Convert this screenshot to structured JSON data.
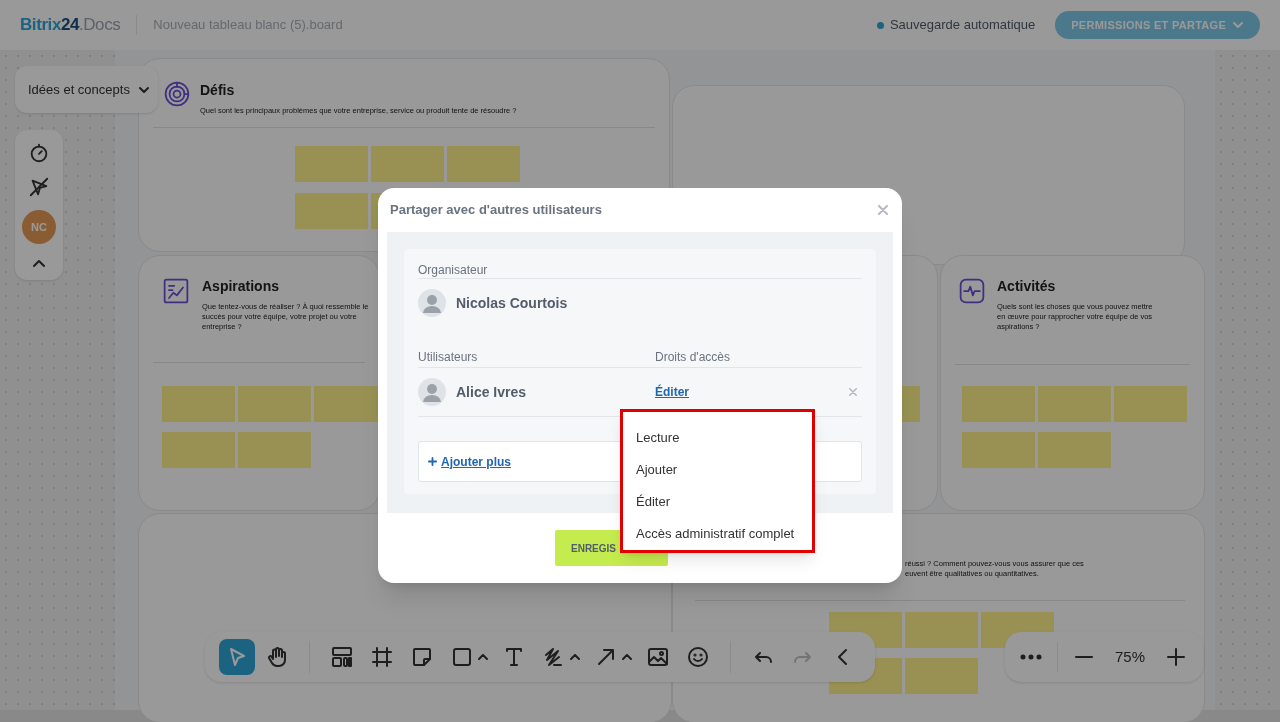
{
  "header": {
    "logo": {
      "brand": "Bitrix",
      "number": "24",
      "suffix": ".Docs"
    },
    "file_name": "Nouveau tableau blanc (5).board",
    "autosave": "Sauvegarde automatique",
    "share_button": "PERMISSIONS ET PARTAGE"
  },
  "board_menu": {
    "label": "Idées et concepts"
  },
  "side_tools": [
    {
      "kind": "timer"
    },
    {
      "kind": "cursor_off"
    },
    {
      "kind": "avatar",
      "initials": "NC"
    },
    {
      "kind": "collapse"
    }
  ],
  "cards": [
    {
      "title": "Défis",
      "description": "Quel sont les principaux problèmes que votre entreprise, service ou produit tente de résoudre ?"
    },
    {
      "title": "Aspirations",
      "description": "Que tentez-vous de réaliser ? À quoi ressemble le succès pour votre équipe, votre projet ou votre entreprise ?"
    },
    {
      "title": "Activités",
      "description": "Quels sont les choses que vous pouvez mettre en œuvre pour rapprocher votre équipe de vos aspirations ?"
    }
  ],
  "partial_card_text": [
    "réussi ? Comment pouvez-vous vous assurer que ces",
    "euvent être qualitatives ou quantitatives."
  ],
  "toolbar": {
    "groups": [
      [
        {
          "kind": "select",
          "selected": true
        },
        {
          "kind": "hand",
          "selected": false
        }
      ],
      [
        {
          "kind": "layout",
          "selected": false
        },
        {
          "kind": "frame",
          "selected": false
        },
        {
          "kind": "sticky",
          "selected": false
        },
        {
          "kind": "shape",
          "selected": false,
          "has_menu": true
        },
        {
          "kind": "text",
          "selected": false
        },
        {
          "kind": "pen",
          "selected": false,
          "has_menu": true
        },
        {
          "kind": "arrow",
          "selected": false,
          "has_menu": true
        },
        {
          "kind": "image",
          "selected": false
        },
        {
          "kind": "emoji",
          "selected": false
        }
      ],
      [
        {
          "kind": "undo",
          "disabled": false
        },
        {
          "kind": "redo",
          "disabled": true
        },
        {
          "kind": "collapse",
          "disabled": false
        }
      ]
    ]
  },
  "zoom": {
    "label": "75%"
  },
  "dialog": {
    "title": "Partager avec d'autres utilisateurs",
    "organizer_label": "Organisateur",
    "organizer": "Nicolas Courtois",
    "users_label": "Utilisateurs",
    "rights_label": "Droits d'accès",
    "users": [
      {
        "name": "Alice Ivres",
        "right": "Éditer"
      }
    ],
    "add_more": "Ajouter plus",
    "save_button": "ENREGIS"
  },
  "access_menu": {
    "options": [
      "Lecture",
      "Ajouter",
      "Éditer",
      "Accès administratif complet"
    ]
  }
}
